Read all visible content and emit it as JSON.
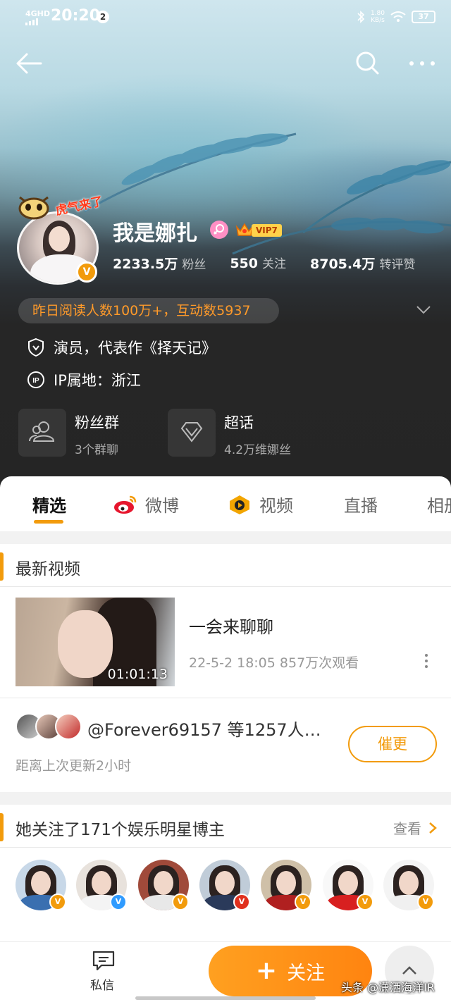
{
  "status_bar": {
    "network": "4GHD",
    "time": "20:20",
    "notification_count": "2",
    "speed": "1.80",
    "speed_unit": "KB/s",
    "battery": "37"
  },
  "profile": {
    "name": "我是娜扎",
    "vip_label": "VIP7",
    "badge_text": "虎气来了",
    "verified_mark": "V",
    "stats": [
      {
        "value": "2233.5万",
        "unit": "粉丝"
      },
      {
        "value": "550",
        "unit": "关注"
      },
      {
        "value": "8705.4万",
        "unit": "转评赞"
      }
    ],
    "read_summary": "昨日阅读人数100万+，互动数5937",
    "description": "演员，代表作《择天记》",
    "ip_location": "IP属地：浙江"
  },
  "cards": [
    {
      "title": "粉丝群",
      "subtitle": "3个群聊",
      "icon": "people-icon"
    },
    {
      "title": "超话",
      "subtitle": "4.2万维娜丝",
      "icon": "diamond-icon"
    }
  ],
  "tabs": [
    {
      "label": "精选",
      "active": true
    },
    {
      "label": "微博",
      "icon": "weibo-icon"
    },
    {
      "label": "视频",
      "icon": "video-icon"
    },
    {
      "label": "直播"
    },
    {
      "label": "相册"
    }
  ],
  "latest_video": {
    "section_title": "最新视频",
    "title": "一会来聊聊",
    "duration": "01:01:13",
    "meta": "22-5-2 18:05 857万次观看"
  },
  "urge": {
    "text": "@Forever69157 等1257人…",
    "subtext": "距离上次更新2小时",
    "button": "催更"
  },
  "following": {
    "section_title": "她关注了171个娱乐明星博主",
    "see_more": "查看",
    "badges": [
      "V",
      "V",
      "V",
      "V",
      "V",
      "V",
      "V"
    ]
  },
  "bottom_bar": {
    "dm_label": "私信",
    "follow_label": "关注",
    "watermark": "头条 @潇洒海洋IR"
  },
  "colors": {
    "accent": "#f29b0c",
    "follow_button": "#ff9418",
    "read_summary": "#ff9a2a",
    "vip": "#ffd24a"
  }
}
